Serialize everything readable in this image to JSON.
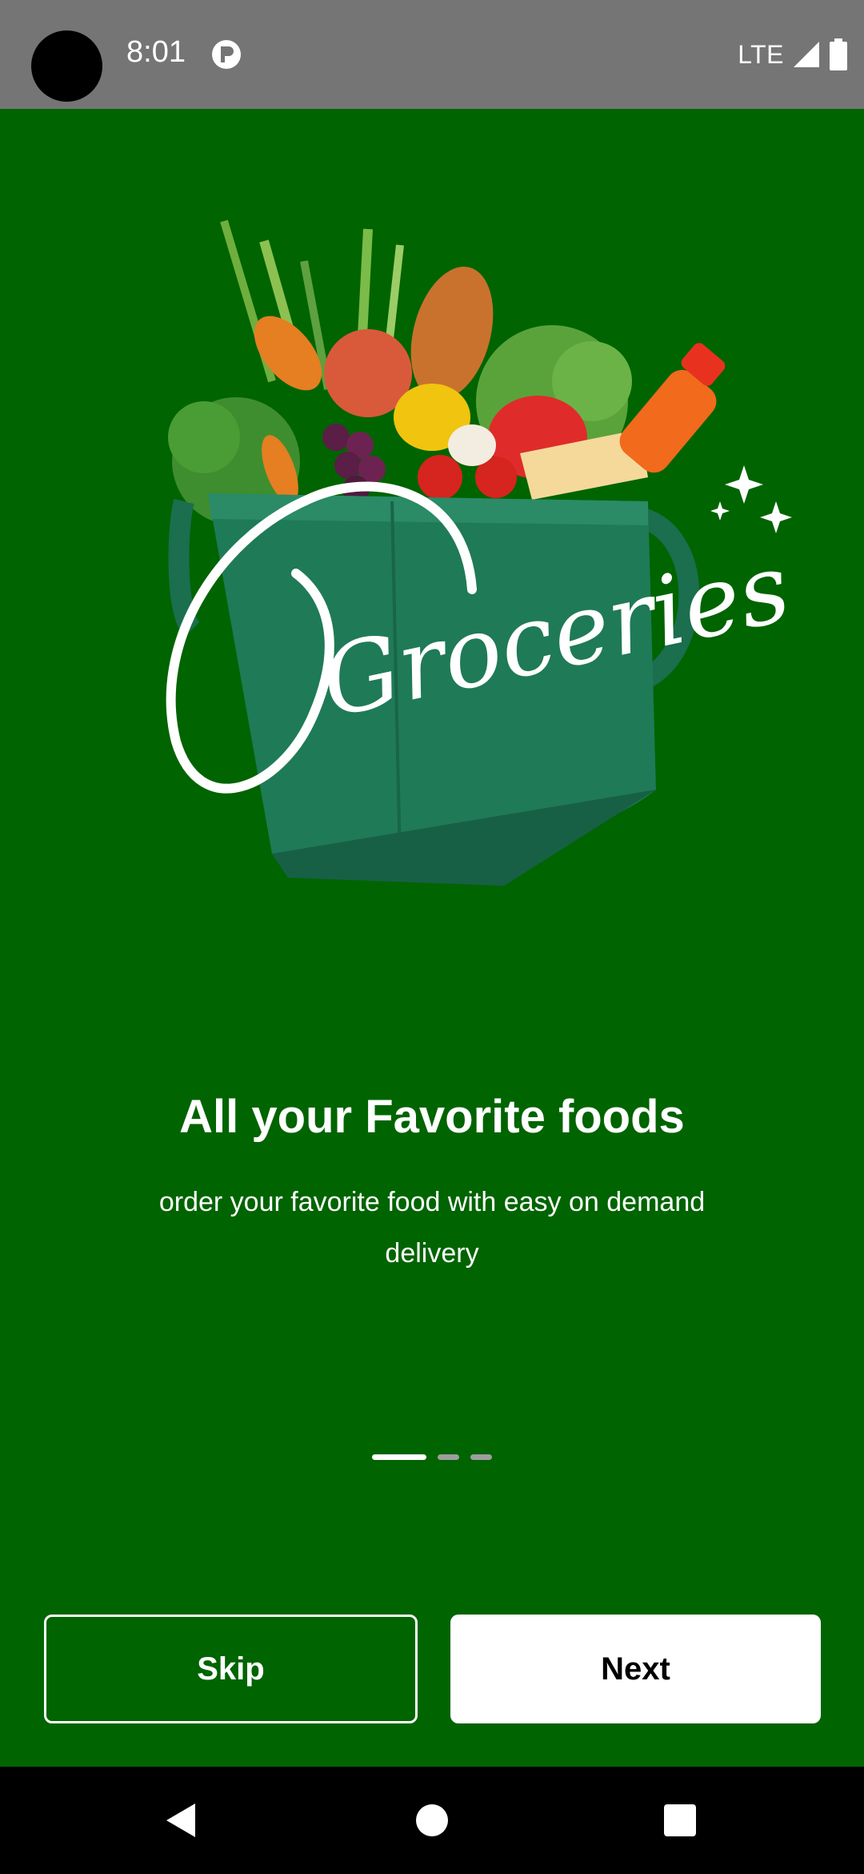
{
  "status_bar": {
    "time": "8:01",
    "network": "LTE",
    "icons": [
      "camera-cutout",
      "app-notification-icon",
      "signal-icon",
      "battery-icon"
    ]
  },
  "hero": {
    "logo_text": "Groceries",
    "image": "grocery-bag-illustration"
  },
  "onboarding": {
    "title": "All your Favorite foods",
    "subtitle": "order your favorite food with easy on demand delivery",
    "page_index": 1,
    "page_count": 3
  },
  "buttons": {
    "skip": "Skip",
    "next": "Next"
  },
  "nav_bar": {
    "icons": [
      "back-icon",
      "home-icon",
      "recents-icon"
    ]
  },
  "colors": {
    "background": "#006400",
    "status_bar": "#757575",
    "accent": "#ffffff",
    "bag": "#1f7a57"
  }
}
